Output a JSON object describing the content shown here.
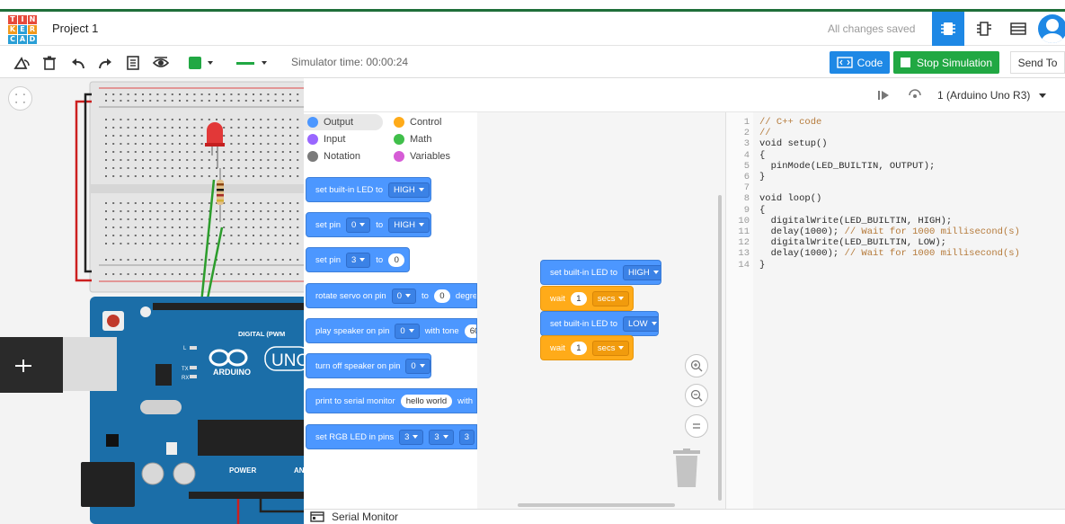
{
  "header": {
    "logo_letters": [
      "T",
      "I",
      "N",
      "K",
      "E",
      "R",
      "C",
      "A",
      "D"
    ],
    "project_title": "Project 1",
    "save_status": "All changes saved",
    "view_icons": [
      "circuit-view-icon",
      "schematic-view-icon",
      "component-list-icon"
    ],
    "accent_color": "#1e88e5"
  },
  "toolbar": {
    "simulator_time": "Simulator time: 00:00:24",
    "code_label": "Code",
    "stop_label": "Stop Simulation",
    "send_label": "Send To",
    "fill_color": "#21a843"
  },
  "code_panel": {
    "device": "1 (Arduino Uno R3)"
  },
  "categories": [
    {
      "label": "Output",
      "color": "#4c97ff"
    },
    {
      "label": "Control",
      "color": "#ffab19"
    },
    {
      "label": "Input",
      "color": "#9966ff"
    },
    {
      "label": "Math",
      "color": "#40bf4a"
    },
    {
      "label": "Notation",
      "color": "#7a7a7a"
    },
    {
      "label": "Variables",
      "color": "#d65cd6"
    }
  ],
  "palette_blocks": [
    {
      "text": "set built-in LED to",
      "dd1": "HIGH"
    },
    {
      "text": "set pin",
      "dd1": "0",
      "mid": "to",
      "dd2": "HIGH"
    },
    {
      "text": "set pin",
      "dd1": "3",
      "mid": "to",
      "pill": "0"
    },
    {
      "text": "rotate servo on pin",
      "dd1": "0",
      "mid": "to",
      "pill": "0",
      "tail": "degre"
    },
    {
      "text": "play speaker on pin",
      "dd1": "0",
      "mid": "with tone",
      "pill": "60"
    },
    {
      "text": "turn off speaker on pin",
      "dd1": "0"
    },
    {
      "text": "print to serial monitor",
      "pill": "hello world",
      "tail": "with"
    },
    {
      "text": "set RGB LED in pins",
      "dd1": "3",
      "dd2": "3",
      "tail": "3"
    }
  ],
  "script_blocks": [
    {
      "type": "blue",
      "text": "set built-in LED to",
      "dd": "HIGH"
    },
    {
      "type": "orange",
      "text": "wait",
      "pill": "1",
      "dd": "secs"
    },
    {
      "type": "blue",
      "text": "set built-in LED to",
      "dd": "LOW"
    },
    {
      "type": "orange",
      "text": "wait",
      "pill": "1",
      "dd": "secs"
    }
  ],
  "code_lines": [
    {
      "n": "1",
      "code": "",
      "comment": "// C++ code"
    },
    {
      "n": "2",
      "code": "",
      "comment": "//"
    },
    {
      "n": "3",
      "code": "void setup()",
      "comment": ""
    },
    {
      "n": "4",
      "code": "{",
      "comment": ""
    },
    {
      "n": "5",
      "code": "  pinMode(LED_BUILTIN, OUTPUT);",
      "comment": ""
    },
    {
      "n": "6",
      "code": "}",
      "comment": ""
    },
    {
      "n": "7",
      "code": "",
      "comment": ""
    },
    {
      "n": "8",
      "code": "void loop()",
      "comment": ""
    },
    {
      "n": "9",
      "code": "{",
      "comment": ""
    },
    {
      "n": "10",
      "code": "  digitalWrite(LED_BUILTIN, HIGH);",
      "comment": ""
    },
    {
      "n": "11",
      "code": "  delay(1000); ",
      "comment": "// Wait for 1000 millisecond(s)"
    },
    {
      "n": "12",
      "code": "  digitalWrite(LED_BUILTIN, LOW);",
      "comment": ""
    },
    {
      "n": "13",
      "code": "  delay(1000); ",
      "comment": "// Wait for 1000 millisecond(s)"
    },
    {
      "n": "14",
      "code": "}",
      "comment": ""
    }
  ],
  "board": {
    "brand": "ARDUINO",
    "model": "UNO",
    "digital_label": "DIGITAL (PWM",
    "power_label": "POWER",
    "analog_label": "AN",
    "tx": "TX",
    "rx": "RX",
    "l": "L"
  },
  "serial_monitor": "Serial Monitor"
}
